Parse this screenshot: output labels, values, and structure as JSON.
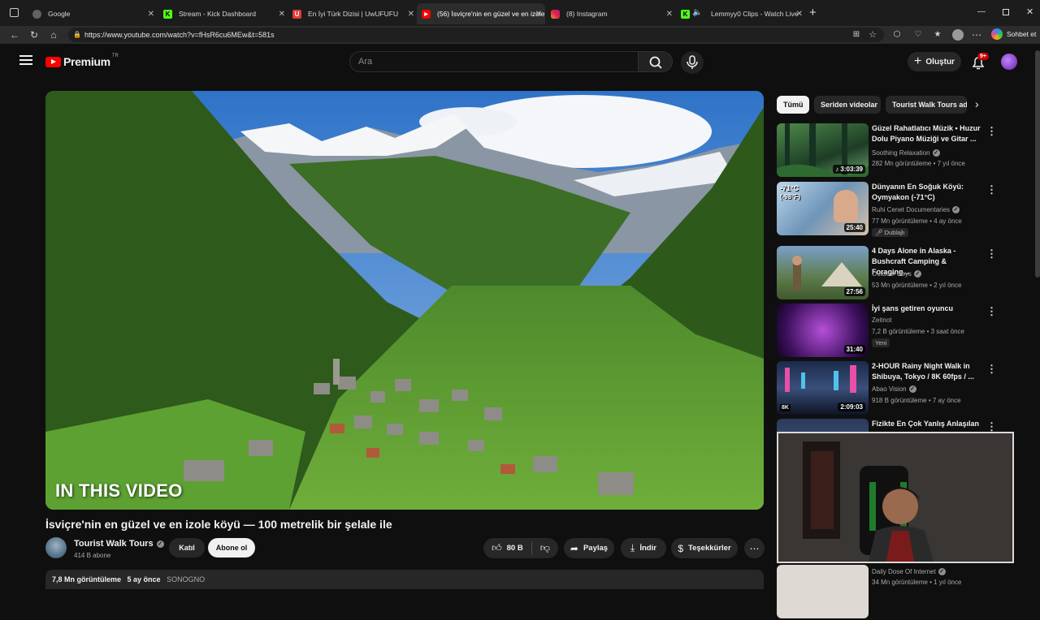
{
  "browser": {
    "tabs": [
      {
        "title": "Google",
        "favicon_color": "#5f6368"
      },
      {
        "title": "Stream - Kick Dashboard",
        "favicon_color": "#53fc18"
      },
      {
        "title": "En İyi Türk Dizisi | UwUFUFU",
        "favicon_color": "#e53935"
      },
      {
        "title": "(56) İsviçre'nin en güzel ve en izole",
        "favicon_color": "#ff0000"
      },
      {
        "title": "(8) Instagram",
        "favicon_color": "#e1306c"
      },
      {
        "title": "Lemmyy0 Clips - Watch Live",
        "favicon_color": "#53fc18"
      }
    ],
    "url": "https://www.youtube.com/watch?v=fHsR6cu6MEw&t=581s",
    "copilot_label": "Sohbet et"
  },
  "header": {
    "logo_text": "Premium",
    "logo_region": "TR",
    "search_placeholder": "Ara",
    "create_label": "Oluştur",
    "notification_count": "9+"
  },
  "video": {
    "overlay_text": "IN THIS VIDEO",
    "title": "İsviçre'nin en güzel ve en izole köyü — 100 metrelik bir şelale ile",
    "channel": "Tourist Walk Tours",
    "subscribers": "414 B abone",
    "join_label": "Katıl",
    "subscribe_label": "Abone ol",
    "likes": "80 B",
    "share_label": "Paylaş",
    "download_label": "İndir",
    "thanks_label": "Teşekkürler",
    "views": "7,8 Mn görüntüleme",
    "age": "5 ay önce",
    "tag": "SONOGNO"
  },
  "chips": [
    "Tümü",
    "Seriden videolar",
    "Tourist Walk Tours ad"
  ],
  "recommendations": [
    {
      "title": "Güzel Rahatlatıcı Müzik • Huzur Dolu Piyano Müziği ve Gitar ...",
      "channel": "Soothing Relaxation",
      "verified": true,
      "meta": "282 Mn görüntüleme • 7 yıl önce",
      "duration": "3:03:39",
      "badge": ""
    },
    {
      "title": "Dünyanın En Soğuk Köyü: Oymyakon (-71°C)",
      "channel": "Ruhi Cenet Documentaries",
      "verified": true,
      "meta": "77 Mn görüntüleme • 4 ay önce",
      "duration": "25:40",
      "badge": "Dublajlı"
    },
    {
      "title": "4 Days Alone in Alaska - Bushcraft Camping & Foraging...",
      "channel": "Outdoor Boys",
      "verified": true,
      "meta": "53 Mn görüntüleme • 2 yıl önce",
      "duration": "27:56",
      "badge": ""
    },
    {
      "title": "İyi şans getiren oyuncu",
      "channel": "Zeitnot",
      "verified": false,
      "meta": "7,2 B görüntüleme • 3 saat önce",
      "duration": "31:40",
      "badge": "Yeni"
    },
    {
      "title": "2-HOUR Rainy Night Walk in Shibuya, Tokyo / 8K 60fps / ...",
      "channel": "Abao Vision",
      "verified": true,
      "meta": "918 B görüntüleme • 7 ay önce",
      "duration": "2:09:03",
      "badge": ""
    },
    {
      "title": "Fizikte En Çok Yanlış Anlaşılan",
      "channel": "",
      "verified": false,
      "meta": "",
      "duration": "",
      "badge": ""
    },
    {
      "title": "",
      "channel": "Daily Dose Of Internet",
      "verified": true,
      "meta": "34 Mn görüntüleme • 1 yıl önce",
      "duration": "",
      "badge": ""
    }
  ],
  "thumb_overlay": {
    "temp_c": "-71°C",
    "temp_f": "(-98°F)",
    "resolution": "8K"
  }
}
